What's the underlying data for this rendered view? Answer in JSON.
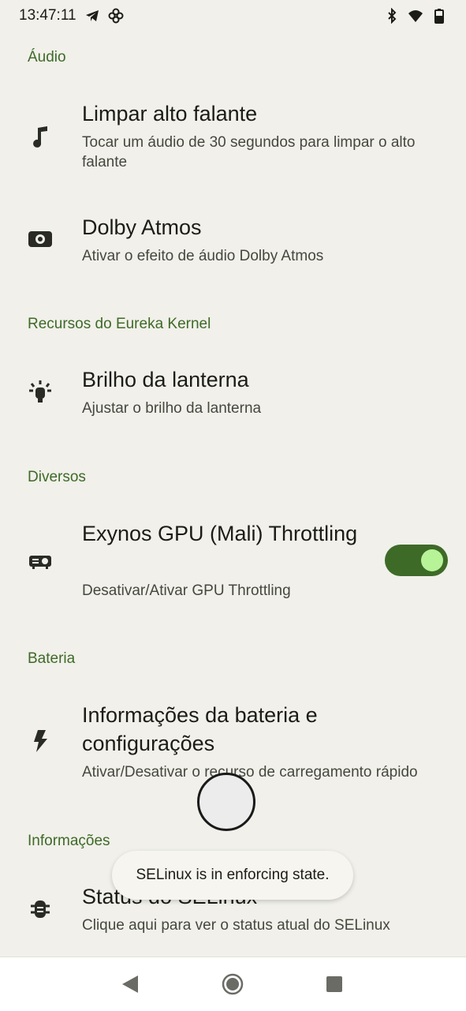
{
  "status_bar": {
    "time": "13:47:11",
    "left_icons": [
      "telegram-icon",
      "pinwheel-icon"
    ],
    "right_icons": [
      "bluetooth-icon",
      "wifi-icon",
      "battery-icon"
    ]
  },
  "sections": {
    "audio": {
      "header": "Áudio",
      "items": [
        {
          "title": "Limpar alto falante",
          "summary": "Tocar um áudio de 30 segundos para limpar o alto falante",
          "icon": "music-note-icon"
        },
        {
          "title": "Dolby Atmos",
          "summary": "Ativar o efeito de áudio Dolby Atmos",
          "icon": "speaker-icon"
        }
      ]
    },
    "kernel": {
      "header": "Recursos do Eureka Kernel",
      "items": [
        {
          "title": "Brilho da lanterna",
          "summary": "Ajustar o brilho da lanterna",
          "icon": "flashlight-icon"
        }
      ]
    },
    "misc": {
      "header": "Diversos",
      "items": [
        {
          "title": "Exynos GPU (Mali) Throttling",
          "summary": "Desativar/Ativar GPU Throttling",
          "icon": "gpu-icon",
          "toggle_on": true
        }
      ]
    },
    "battery": {
      "header": "Bateria",
      "items": [
        {
          "title": "Informações da bateria e configurações",
          "summary": "Ativar/Desativar o recurso de carregamento rápido",
          "icon": "bolt-icon"
        }
      ]
    },
    "info": {
      "header": "Informações",
      "items": [
        {
          "title": "Status do SELinux",
          "summary": "Clique aqui para ver o status atual do SELinux",
          "icon": "bug-icon"
        }
      ]
    }
  },
  "toast": {
    "message": "SELinux is in enforcing state."
  },
  "colors": {
    "accent": "#3e6a28",
    "toggle_thumb": "#b7f397",
    "background": "#f1f0ea"
  },
  "nav_bar": {
    "buttons": [
      "back-icon",
      "home-icon",
      "recents-icon"
    ]
  }
}
